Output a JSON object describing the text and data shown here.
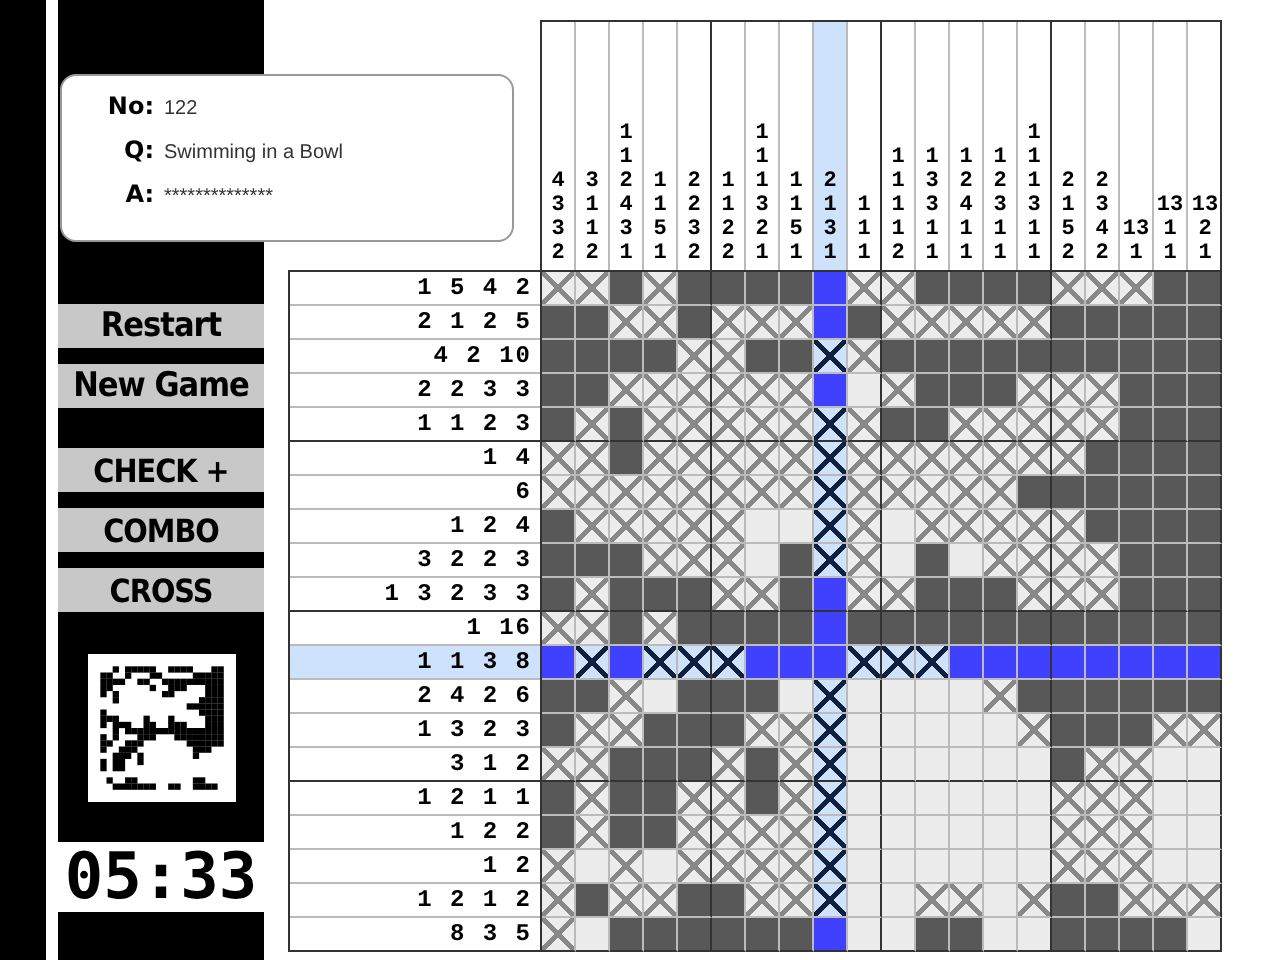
{
  "puzzle": {
    "no_label": "No:",
    "no": "122",
    "q_label": "Q:",
    "question": "Swimming in a Bowl",
    "a_label": "A:",
    "answer": "**************"
  },
  "game_buttons": [
    {
      "label": "Restart"
    },
    {
      "label": "New Game"
    }
  ],
  "mode_buttons": [
    {
      "label": "CHECK +"
    },
    {
      "label": "COMBO"
    },
    {
      "label": "CROSS"
    }
  ],
  "timer": "05:33",
  "columns": [
    {
      "clue": "4 3 3 2",
      "selected": false
    },
    {
      "clue": "3 1 1 2",
      "selected": false
    },
    {
      "clue": "1 1 2 4 3 1",
      "selected": false
    },
    {
      "clue": "1 1 5 1",
      "selected": false
    },
    {
      "clue": "2 2 3 2",
      "selected": false
    },
    {
      "clue": "1 1 2 2",
      "selected": false
    },
    {
      "clue": "1 1 1 3 2 1",
      "selected": false
    },
    {
      "clue": "1 1 5 1",
      "selected": false
    },
    {
      "clue": "2 1 3 1",
      "selected": true
    },
    {
      "clue": "1 1 1",
      "selected": false
    },
    {
      "clue": "1 1 1 1 2",
      "selected": false
    },
    {
      "clue": "1 3 3 1 1",
      "selected": false
    },
    {
      "clue": "1 2 4 1 1",
      "selected": false
    },
    {
      "clue": "1 2 3 1 1",
      "selected": false
    },
    {
      "clue": "1 1 1 3 1 1",
      "selected": false
    },
    {
      "clue": "2 1 5 2",
      "selected": false
    },
    {
      "clue": "2 3 4 2",
      "selected": false
    },
    {
      "clue": "13 1",
      "selected": false
    },
    {
      "clue": "13 1 1",
      "selected": false
    },
    {
      "clue": "13 2 1",
      "selected": false
    }
  ],
  "rows": [
    {
      "clue": "1 5 4 2",
      "selected": false,
      "cells": [
        {
          "kind": "crossed"
        },
        {
          "kind": "crossed"
        },
        {
          "kind": "filled"
        },
        {
          "kind": "crossed"
        },
        {
          "kind": "filled"
        },
        {
          "kind": "filled"
        },
        {
          "kind": "filled"
        },
        {
          "kind": "filled"
        },
        {
          "kind": "filled"
        },
        {
          "kind": "crossed"
        },
        {
          "kind": "crossed"
        },
        {
          "kind": "filled"
        },
        {
          "kind": "filled"
        },
        {
          "kind": "filled"
        },
        {
          "kind": "filled"
        },
        {
          "kind": "crossed"
        },
        {
          "kind": "crossed"
        },
        {
          "kind": "crossed"
        },
        {
          "kind": "filled"
        },
        {
          "kind": "filled"
        }
      ]
    },
    {
      "clue": "2 1 2 5",
      "selected": false,
      "cells": [
        {
          "kind": "filled"
        },
        {
          "kind": "filled"
        },
        {
          "kind": "crossed"
        },
        {
          "kind": "crossed"
        },
        {
          "kind": "filled"
        },
        {
          "kind": "crossed"
        },
        {
          "kind": "crossed"
        },
        {
          "kind": "crossed"
        },
        {
          "kind": "filled"
        },
        {
          "kind": "filled"
        },
        {
          "kind": "crossed"
        },
        {
          "kind": "crossed"
        },
        {
          "kind": "crossed"
        },
        {
          "kind": "crossed"
        },
        {
          "kind": "crossed"
        },
        {
          "kind": "filled"
        },
        {
          "kind": "filled"
        },
        {
          "kind": "filled"
        },
        {
          "kind": "filled"
        },
        {
          "kind": "filled"
        }
      ]
    },
    {
      "clue": "4 2 10",
      "selected": false,
      "cells": [
        {
          "kind": "filled"
        },
        {
          "kind": "filled"
        },
        {
          "kind": "filled"
        },
        {
          "kind": "filled"
        },
        {
          "kind": "crossed"
        },
        {
          "kind": "crossed"
        },
        {
          "kind": "filled"
        },
        {
          "kind": "filled"
        },
        {
          "kind": "crossed"
        },
        {
          "kind": "crossed"
        },
        {
          "kind": "filled"
        },
        {
          "kind": "filled"
        },
        {
          "kind": "filled"
        },
        {
          "kind": "filled"
        },
        {
          "kind": "filled"
        },
        {
          "kind": "filled"
        },
        {
          "kind": "filled"
        },
        {
          "kind": "filled"
        },
        {
          "kind": "filled"
        },
        {
          "kind": "filled"
        }
      ]
    },
    {
      "clue": "2 2 3 3",
      "selected": false,
      "cells": [
        {
          "kind": "filled"
        },
        {
          "kind": "filled"
        },
        {
          "kind": "crossed"
        },
        {
          "kind": "crossed"
        },
        {
          "kind": "crossed"
        },
        {
          "kind": "crossed"
        },
        {
          "kind": "crossed"
        },
        {
          "kind": "crossed"
        },
        {
          "kind": "filled"
        },
        {
          "kind": "empty"
        },
        {
          "kind": "crossed"
        },
        {
          "kind": "filled"
        },
        {
          "kind": "filled"
        },
        {
          "kind": "filled"
        },
        {
          "kind": "crossed"
        },
        {
          "kind": "crossed"
        },
        {
          "kind": "crossed"
        },
        {
          "kind": "filled"
        },
        {
          "kind": "filled"
        },
        {
          "kind": "filled"
        }
      ]
    },
    {
      "clue": "1 1 2 3",
      "selected": false,
      "cells": [
        {
          "kind": "filled"
        },
        {
          "kind": "crossed"
        },
        {
          "kind": "filled"
        },
        {
          "kind": "crossed"
        },
        {
          "kind": "crossed"
        },
        {
          "kind": "crossed"
        },
        {
          "kind": "crossed"
        },
        {
          "kind": "crossed"
        },
        {
          "kind": "crossed"
        },
        {
          "kind": "crossed"
        },
        {
          "kind": "filled"
        },
        {
          "kind": "filled"
        },
        {
          "kind": "crossed"
        },
        {
          "kind": "crossed"
        },
        {
          "kind": "crossed"
        },
        {
          "kind": "crossed"
        },
        {
          "kind": "crossed"
        },
        {
          "kind": "filled"
        },
        {
          "kind": "filled"
        },
        {
          "kind": "filled"
        }
      ]
    },
    {
      "clue": "1 4",
      "selected": false,
      "cells": [
        {
          "kind": "crossed"
        },
        {
          "kind": "crossed"
        },
        {
          "kind": "filled"
        },
        {
          "kind": "crossed"
        },
        {
          "kind": "crossed"
        },
        {
          "kind": "crossed"
        },
        {
          "kind": "crossed"
        },
        {
          "kind": "crossed"
        },
        {
          "kind": "crossed"
        },
        {
          "kind": "crossed"
        },
        {
          "kind": "crossed"
        },
        {
          "kind": "crossed"
        },
        {
          "kind": "crossed"
        },
        {
          "kind": "crossed"
        },
        {
          "kind": "crossed"
        },
        {
          "kind": "crossed"
        },
        {
          "kind": "filled"
        },
        {
          "kind": "filled"
        },
        {
          "kind": "filled"
        },
        {
          "kind": "filled"
        }
      ]
    },
    {
      "clue": "6",
      "selected": false,
      "cells": [
        {
          "kind": "crossed"
        },
        {
          "kind": "crossed"
        },
        {
          "kind": "crossed"
        },
        {
          "kind": "crossed"
        },
        {
          "kind": "crossed"
        },
        {
          "kind": "crossed"
        },
        {
          "kind": "crossed"
        },
        {
          "kind": "crossed"
        },
        {
          "kind": "crossed"
        },
        {
          "kind": "crossed"
        },
        {
          "kind": "crossed"
        },
        {
          "kind": "crossed"
        },
        {
          "kind": "crossed"
        },
        {
          "kind": "crossed"
        },
        {
          "kind": "filled"
        },
        {
          "kind": "filled"
        },
        {
          "kind": "filled"
        },
        {
          "kind": "filled"
        },
        {
          "kind": "filled"
        },
        {
          "kind": "filled"
        }
      ]
    },
    {
      "clue": "1 2 4",
      "selected": false,
      "cells": [
        {
          "kind": "filled"
        },
        {
          "kind": "crossed"
        },
        {
          "kind": "crossed"
        },
        {
          "kind": "crossed"
        },
        {
          "kind": "crossed"
        },
        {
          "kind": "crossed"
        },
        {
          "kind": "empty"
        },
        {
          "kind": "empty"
        },
        {
          "kind": "crossed"
        },
        {
          "kind": "crossed"
        },
        {
          "kind": "empty"
        },
        {
          "kind": "crossed"
        },
        {
          "kind": "crossed"
        },
        {
          "kind": "crossed"
        },
        {
          "kind": "crossed"
        },
        {
          "kind": "crossed"
        },
        {
          "kind": "filled"
        },
        {
          "kind": "filled"
        },
        {
          "kind": "filled"
        },
        {
          "kind": "filled"
        }
      ]
    },
    {
      "clue": "3 2 2 3",
      "selected": false,
      "cells": [
        {
          "kind": "filled"
        },
        {
          "kind": "filled"
        },
        {
          "kind": "filled"
        },
        {
          "kind": "crossed"
        },
        {
          "kind": "crossed"
        },
        {
          "kind": "crossed"
        },
        {
          "kind": "empty"
        },
        {
          "kind": "filled"
        },
        {
          "kind": "crossed"
        },
        {
          "kind": "crossed"
        },
        {
          "kind": "empty"
        },
        {
          "kind": "filled"
        },
        {
          "kind": "empty"
        },
        {
          "kind": "crossed"
        },
        {
          "kind": "crossed"
        },
        {
          "kind": "crossed"
        },
        {
          "kind": "crossed"
        },
        {
          "kind": "filled"
        },
        {
          "kind": "filled"
        },
        {
          "kind": "filled"
        }
      ]
    },
    {
      "clue": "1 3 2 3 3",
      "selected": false,
      "cells": [
        {
          "kind": "filled"
        },
        {
          "kind": "crossed"
        },
        {
          "kind": "filled"
        },
        {
          "kind": "filled"
        },
        {
          "kind": "filled"
        },
        {
          "kind": "crossed"
        },
        {
          "kind": "crossed"
        },
        {
          "kind": "filled"
        },
        {
          "kind": "filled"
        },
        {
          "kind": "crossed"
        },
        {
          "kind": "crossed"
        },
        {
          "kind": "filled"
        },
        {
          "kind": "filled"
        },
        {
          "kind": "filled"
        },
        {
          "kind": "crossed"
        },
        {
          "kind": "crossed"
        },
        {
          "kind": "crossed"
        },
        {
          "kind": "filled"
        },
        {
          "kind": "filled"
        },
        {
          "kind": "filled"
        }
      ]
    },
    {
      "clue": "1 16",
      "selected": false,
      "cells": [
        {
          "kind": "crossed"
        },
        {
          "kind": "crossed"
        },
        {
          "kind": "filled"
        },
        {
          "kind": "crossed"
        },
        {
          "kind": "filled"
        },
        {
          "kind": "filled"
        },
        {
          "kind": "filled"
        },
        {
          "kind": "filled"
        },
        {
          "kind": "filled"
        },
        {
          "kind": "filled"
        },
        {
          "kind": "filled"
        },
        {
          "kind": "filled"
        },
        {
          "kind": "filled"
        },
        {
          "kind": "filled"
        },
        {
          "kind": "filled"
        },
        {
          "kind": "filled"
        },
        {
          "kind": "filled"
        },
        {
          "kind": "filled"
        },
        {
          "kind": "filled"
        },
        {
          "kind": "filled"
        }
      ]
    },
    {
      "clue": "1 1 3 8",
      "selected": true,
      "cells": [
        {
          "kind": "filled"
        },
        {
          "kind": "crossed"
        },
        {
          "kind": "filled"
        },
        {
          "kind": "crossed"
        },
        {
          "kind": "crossed"
        },
        {
          "kind": "crossed"
        },
        {
          "kind": "filled"
        },
        {
          "kind": "filled"
        },
        {
          "kind": "filled"
        },
        {
          "kind": "crossed"
        },
        {
          "kind": "crossed"
        },
        {
          "kind": "crossed"
        },
        {
          "kind": "filled"
        },
        {
          "kind": "filled"
        },
        {
          "kind": "filled"
        },
        {
          "kind": "filled"
        },
        {
          "kind": "filled"
        },
        {
          "kind": "filled"
        },
        {
          "kind": "filled"
        },
        {
          "kind": "filled"
        }
      ]
    },
    {
      "clue": "2 4 2 6",
      "selected": false,
      "cells": [
        {
          "kind": "filled"
        },
        {
          "kind": "filled"
        },
        {
          "kind": "crossed"
        },
        {
          "kind": "empty"
        },
        {
          "kind": "filled"
        },
        {
          "kind": "filled"
        },
        {
          "kind": "filled"
        },
        {
          "kind": "empty"
        },
        {
          "kind": "crossed"
        },
        {
          "kind": "empty"
        },
        {
          "kind": "empty"
        },
        {
          "kind": "empty"
        },
        {
          "kind": "empty"
        },
        {
          "kind": "crossed"
        },
        {
          "kind": "filled"
        },
        {
          "kind": "filled"
        },
        {
          "kind": "filled"
        },
        {
          "kind": "filled"
        },
        {
          "kind": "filled"
        },
        {
          "kind": "filled"
        }
      ]
    },
    {
      "clue": "1 3 2 3",
      "selected": false,
      "cells": [
        {
          "kind": "filled"
        },
        {
          "kind": "crossed"
        },
        {
          "kind": "crossed"
        },
        {
          "kind": "filled"
        },
        {
          "kind": "filled"
        },
        {
          "kind": "filled"
        },
        {
          "kind": "crossed"
        },
        {
          "kind": "crossed"
        },
        {
          "kind": "crossed"
        },
        {
          "kind": "empty"
        },
        {
          "kind": "empty"
        },
        {
          "kind": "empty"
        },
        {
          "kind": "empty"
        },
        {
          "kind": "empty"
        },
        {
          "kind": "crossed"
        },
        {
          "kind": "filled"
        },
        {
          "kind": "filled"
        },
        {
          "kind": "filled"
        },
        {
          "kind": "crossed"
        },
        {
          "kind": "crossed"
        }
      ]
    },
    {
      "clue": "3 1 2",
      "selected": false,
      "cells": [
        {
          "kind": "crossed"
        },
        {
          "kind": "crossed"
        },
        {
          "kind": "filled"
        },
        {
          "kind": "filled"
        },
        {
          "kind": "filled"
        },
        {
          "kind": "crossed"
        },
        {
          "kind": "filled"
        },
        {
          "kind": "crossed"
        },
        {
          "kind": "crossed"
        },
        {
          "kind": "empty"
        },
        {
          "kind": "empty"
        },
        {
          "kind": "empty"
        },
        {
          "kind": "empty"
        },
        {
          "kind": "empty"
        },
        {
          "kind": "empty"
        },
        {
          "kind": "filled"
        },
        {
          "kind": "crossed"
        },
        {
          "kind": "crossed"
        },
        {
          "kind": "empty"
        },
        {
          "kind": "empty"
        }
      ]
    },
    {
      "clue": "1 2 1 1",
      "selected": false,
      "cells": [
        {
          "kind": "filled"
        },
        {
          "kind": "crossed"
        },
        {
          "kind": "filled"
        },
        {
          "kind": "filled"
        },
        {
          "kind": "crossed"
        },
        {
          "kind": "crossed"
        },
        {
          "kind": "filled"
        },
        {
          "kind": "crossed"
        },
        {
          "kind": "crossed"
        },
        {
          "kind": "empty"
        },
        {
          "kind": "empty"
        },
        {
          "kind": "empty"
        },
        {
          "kind": "empty"
        },
        {
          "kind": "empty"
        },
        {
          "kind": "empty"
        },
        {
          "kind": "crossed"
        },
        {
          "kind": "crossed"
        },
        {
          "kind": "crossed"
        },
        {
          "kind": "empty"
        },
        {
          "kind": "empty"
        }
      ]
    },
    {
      "clue": "1 2 2",
      "selected": false,
      "cells": [
        {
          "kind": "filled"
        },
        {
          "kind": "crossed"
        },
        {
          "kind": "filled"
        },
        {
          "kind": "filled"
        },
        {
          "kind": "crossed"
        },
        {
          "kind": "crossed"
        },
        {
          "kind": "crossed"
        },
        {
          "kind": "crossed"
        },
        {
          "kind": "crossed"
        },
        {
          "kind": "empty"
        },
        {
          "kind": "empty"
        },
        {
          "kind": "empty"
        },
        {
          "kind": "empty"
        },
        {
          "kind": "empty"
        },
        {
          "kind": "empty"
        },
        {
          "kind": "crossed"
        },
        {
          "kind": "crossed"
        },
        {
          "kind": "crossed"
        },
        {
          "kind": "empty"
        },
        {
          "kind": "empty"
        }
      ]
    },
    {
      "clue": "1 2",
      "selected": false,
      "cells": [
        {
          "kind": "crossed"
        },
        {
          "kind": "empty"
        },
        {
          "kind": "crossed"
        },
        {
          "kind": "empty"
        },
        {
          "kind": "crossed"
        },
        {
          "kind": "crossed"
        },
        {
          "kind": "crossed"
        },
        {
          "kind": "crossed"
        },
        {
          "kind": "crossed"
        },
        {
          "kind": "empty"
        },
        {
          "kind": "empty"
        },
        {
          "kind": "empty"
        },
        {
          "kind": "empty"
        },
        {
          "kind": "empty"
        },
        {
          "kind": "empty"
        },
        {
          "kind": "crossed"
        },
        {
          "kind": "crossed"
        },
        {
          "kind": "crossed"
        },
        {
          "kind": "empty"
        },
        {
          "kind": "empty"
        }
      ]
    },
    {
      "clue": "1 2 1 2",
      "selected": false,
      "cells": [
        {
          "kind": "crossed"
        },
        {
          "kind": "filled"
        },
        {
          "kind": "crossed"
        },
        {
          "kind": "crossed"
        },
        {
          "kind": "filled"
        },
        {
          "kind": "filled"
        },
        {
          "kind": "crossed"
        },
        {
          "kind": "crossed"
        },
        {
          "kind": "crossed"
        },
        {
          "kind": "empty"
        },
        {
          "kind": "empty"
        },
        {
          "kind": "crossed"
        },
        {
          "kind": "crossed"
        },
        {
          "kind": "empty"
        },
        {
          "kind": "crossed"
        },
        {
          "kind": "filled"
        },
        {
          "kind": "filled"
        },
        {
          "kind": "crossed"
        },
        {
          "kind": "crossed"
        },
        {
          "kind": "crossed"
        }
      ]
    },
    {
      "clue": "8 3 5",
      "selected": false,
      "cells": [
        {
          "kind": "crossed"
        },
        {
          "kind": "empty"
        },
        {
          "kind": "filled"
        },
        {
          "kind": "filled"
        },
        {
          "kind": "filled"
        },
        {
          "kind": "filled"
        },
        {
          "kind": "filled"
        },
        {
          "kind": "filled"
        },
        {
          "kind": "filled"
        },
        {
          "kind": "empty"
        },
        {
          "kind": "empty"
        },
        {
          "kind": "filled"
        },
        {
          "kind": "filled"
        },
        {
          "kind": "empty"
        },
        {
          "kind": "empty"
        },
        {
          "kind": "filled"
        },
        {
          "kind": "filled"
        },
        {
          "kind": "filled"
        },
        {
          "kind": "filled"
        },
        {
          "kind": "empty"
        }
      ]
    }
  ]
}
